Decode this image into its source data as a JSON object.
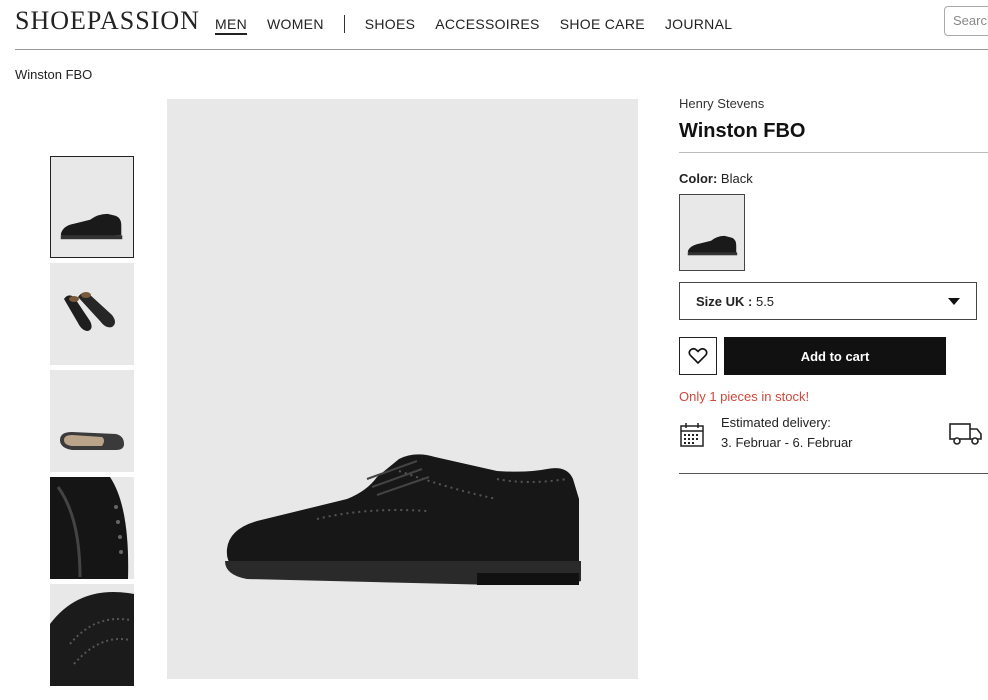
{
  "header": {
    "logo": "SHOEPASSION",
    "nav": [
      "MEN",
      "WOMEN",
      "SHOES",
      "ACCESSOIRES",
      "SHOE CARE",
      "JOURNAL"
    ],
    "active_nav": "MEN",
    "search_placeholder": "Search"
  },
  "breadcrumb": "Winston FBO",
  "gallery": {
    "thumbnails": [
      "side-view",
      "pair-top-view",
      "sole-view",
      "heel-closeup",
      "toe-brogue-closeup"
    ],
    "selected_index": 0
  },
  "product": {
    "brand": "Henry Stevens",
    "name": "Winston FBO",
    "color_label": "Color:",
    "color_value": "Black",
    "size_label": "Size UK :",
    "size_value": "5.5",
    "add_to_cart": "Add to cart",
    "stock_message": "Only 1 pieces in stock!",
    "delivery_label": "Estimated delivery:",
    "delivery_dates": "3. Februar - 6. Februar"
  },
  "colors": {
    "accent": "#111111",
    "stock_warning": "#d0483a",
    "image_background": "#e8e8e8"
  },
  "icons": [
    "heart-icon",
    "calendar-icon",
    "truck-icon",
    "caret-down-icon"
  ]
}
